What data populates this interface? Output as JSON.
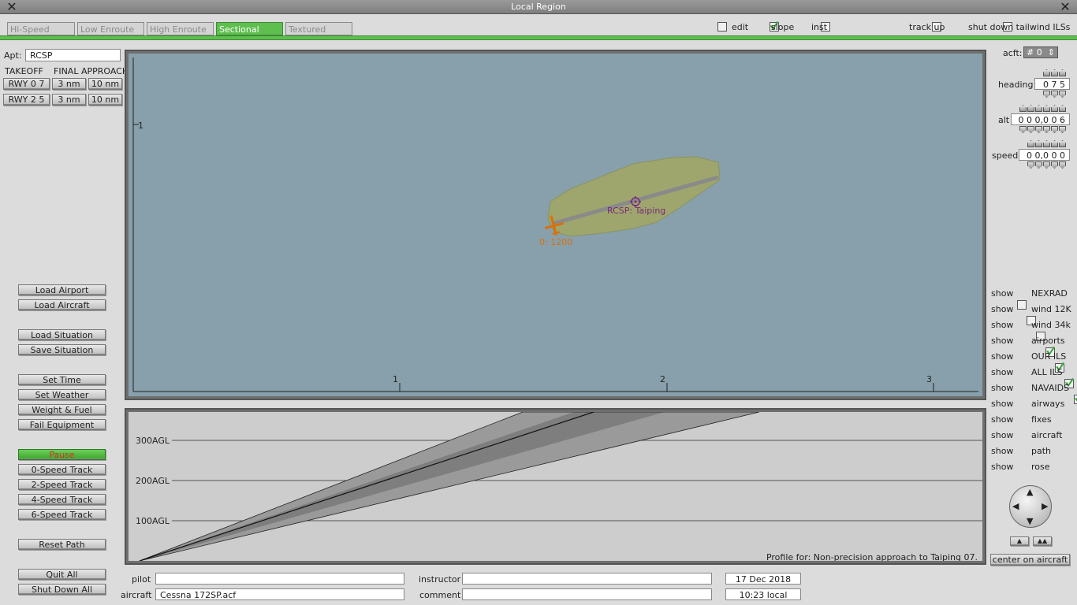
{
  "window": {
    "title": "Local Region"
  },
  "tabs": [
    {
      "label": "Hi-Speed",
      "active": false
    },
    {
      "label": "Low Enroute",
      "active": false
    },
    {
      "label": "High Enroute",
      "active": false
    },
    {
      "label": "Sectional",
      "active": true
    },
    {
      "label": "Textured",
      "active": false
    }
  ],
  "top_options": {
    "edit": {
      "label": "edit",
      "checked": false
    },
    "slope": {
      "label": "slope",
      "checked": true
    },
    "inst": {
      "label": "inst",
      "checked": false
    },
    "track_up": {
      "label": "track up",
      "checked": false
    },
    "shut_down": {
      "label": "shut down tailwind ILSs",
      "checked": false
    }
  },
  "airport": {
    "label": "Apt:",
    "value": "RCSP"
  },
  "runway_table": {
    "takeoff_header": "TAKEOFF",
    "final_header": "FINAL APPROACH",
    "rows": [
      {
        "runway": "RWY 0 7",
        "short": "3 nm",
        "long": "10 nm"
      },
      {
        "runway": "RWY 2 5",
        "short": "3 nm",
        "long": "10 nm"
      }
    ]
  },
  "left_buttons": {
    "load_airport": "Load Airport",
    "load_aircraft": "Load Aircraft",
    "load_situation": "Load Situation",
    "save_situation": "Save Situation",
    "set_time": "Set Time",
    "set_weather": "Set Weather",
    "weight_fuel": "Weight & Fuel",
    "fail_equipment": "Fail Equipment",
    "pause": "Pause",
    "speed0": "0-Speed Track",
    "speed2": "2-Speed Track",
    "speed4": "4-Speed Track",
    "speed6": "6-Speed Track",
    "reset_path": "Reset Path",
    "quit_all": "Quit All",
    "shut_down_all": "Shut Down All"
  },
  "map": {
    "y_tick": "1",
    "x_ticks": [
      "1",
      "2",
      "3"
    ],
    "airport_label": "RCSP: Taiping",
    "aircraft_label": "0: 1200",
    "colors": {
      "water": "#87a0ab",
      "land": "#9ea66d",
      "aircraft": "#d9700a",
      "airport": "#7a2a7a"
    }
  },
  "profile": {
    "agl_labels": [
      "300AGL",
      "200AGL",
      "100AGL"
    ],
    "caption": "Profile for: Non-precision approach to Taiping 07."
  },
  "right_panel": {
    "acft_label": "acft:",
    "acft_value": "# 0",
    "heading_label": "heading",
    "heading_value": "0 7 5",
    "alt_label": "alt",
    "alt_value": "0 0 0,0 0 6",
    "speed_label": "speed",
    "speed_value": "0 0,0 0 0",
    "center_btn": "center on aircraft"
  },
  "show_label": "show",
  "layers": [
    {
      "name": "NEXRAD",
      "checked": false
    },
    {
      "name": "wind 12K",
      "checked": false
    },
    {
      "name": "wind 34k",
      "checked": false
    },
    {
      "name": "airports",
      "checked": true
    },
    {
      "name": "OUR ILS",
      "checked": true
    },
    {
      "name": "ALL ILS",
      "checked": true
    },
    {
      "name": "NAVAIDS",
      "checked": true
    },
    {
      "name": "airways",
      "checked": false
    },
    {
      "name": "fixes",
      "checked": false
    },
    {
      "name": "aircraft",
      "checked": true
    },
    {
      "name": "path",
      "checked": true
    },
    {
      "name": "rose",
      "checked": false
    }
  ],
  "bottom": {
    "pilot_label": "pilot",
    "pilot_value": "",
    "aircraft_label": "aircraft",
    "aircraft_value": "Cessna 172SP.acf",
    "instructor_label": "instructor",
    "instructor_value": "",
    "comment_label": "comment",
    "comment_value": "",
    "date": "17 Dec 2018",
    "time": "10:23 local"
  }
}
